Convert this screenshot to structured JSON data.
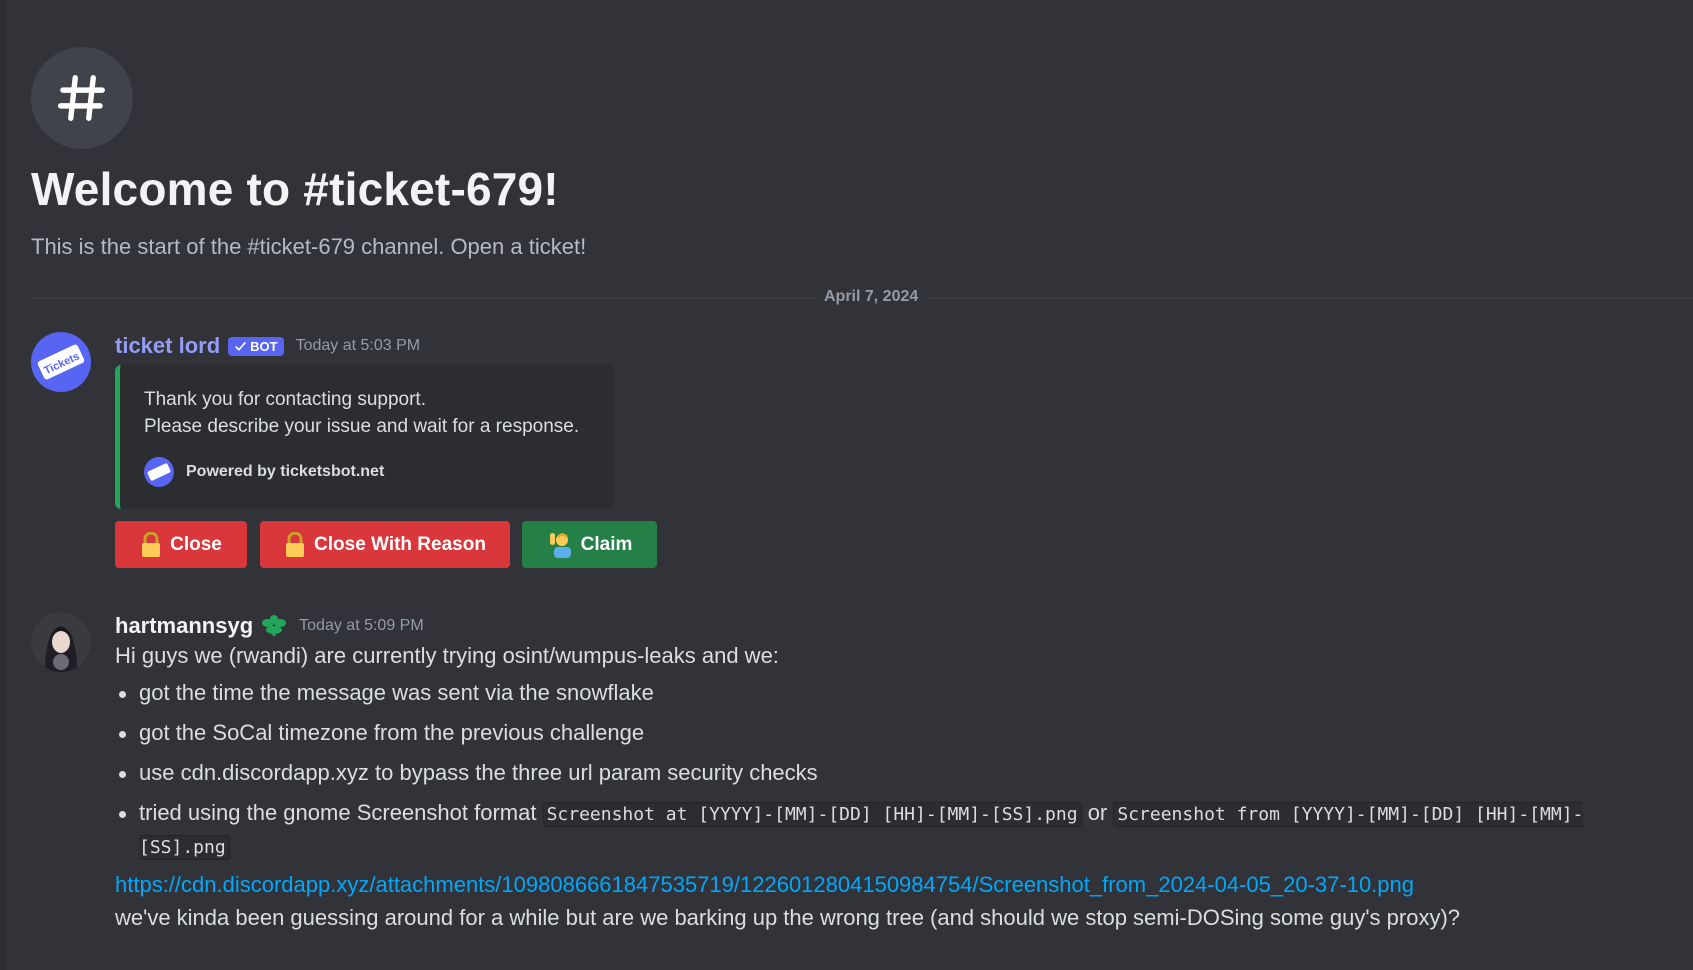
{
  "channel": {
    "icon": "hash-icon",
    "welcome_title": "Welcome to #ticket-679!",
    "welcome_subtitle": "This is the start of the #ticket-679 channel. Open a ticket!"
  },
  "divider_date": "April 7, 2024",
  "bot_message": {
    "avatar": "tickets-bot-avatar",
    "username": "ticket lord",
    "username_color": "#949cf7",
    "badge": "BOT",
    "timestamp": "Today at 5:03 PM",
    "embed": {
      "accent_color": "#23a55a",
      "line1": "Thank you for contacting support.",
      "line2": "Please describe your issue and wait for a response.",
      "footer": "Powered by ticketsbot.net"
    },
    "buttons": [
      {
        "label": "Close",
        "icon": "lock-icon",
        "color": "#da373c"
      },
      {
        "label": "Close With Reason",
        "icon": "lock-icon",
        "color": "#da373c"
      },
      {
        "label": "Claim",
        "icon": "raising-hand-icon",
        "color": "#248046"
      }
    ]
  },
  "user_message": {
    "avatar": "user-avatar",
    "username": "hartmannsyg",
    "username_color": "#f2f3f5",
    "role_icon": "leaf-badge-icon",
    "timestamp": "Today at 5:09 PM",
    "intro": "Hi guys we (rwandi) are currently trying osint/wumpus-leaks and we:",
    "bullets": [
      "got the time the message was sent via the snowflake",
      "got the SoCal timezone from the previous challenge",
      "use cdn.discordapp.xyz to bypass the three url param security checks"
    ],
    "bullet4_text": "tried using the gnome Screenshot format ",
    "bullet4_code1": "Screenshot at [YYYY]-[MM]-[DD] [HH]-[MM]-[SS].png",
    "bullet4_or": " or ",
    "bullet4_code2": "Screenshot from [YYYY]-[MM]-[DD] [HH]-[MM]-[SS].png",
    "link": "https://cdn.discordapp.xyz/attachments/1098086661847535719/1226012804150984754/Screenshot_from_2024-04-05_20-37-10.png",
    "closing": "we've kinda been guessing around for a while but are we barking up the wrong tree (and should we stop semi-DOSing some guy's proxy)?"
  }
}
